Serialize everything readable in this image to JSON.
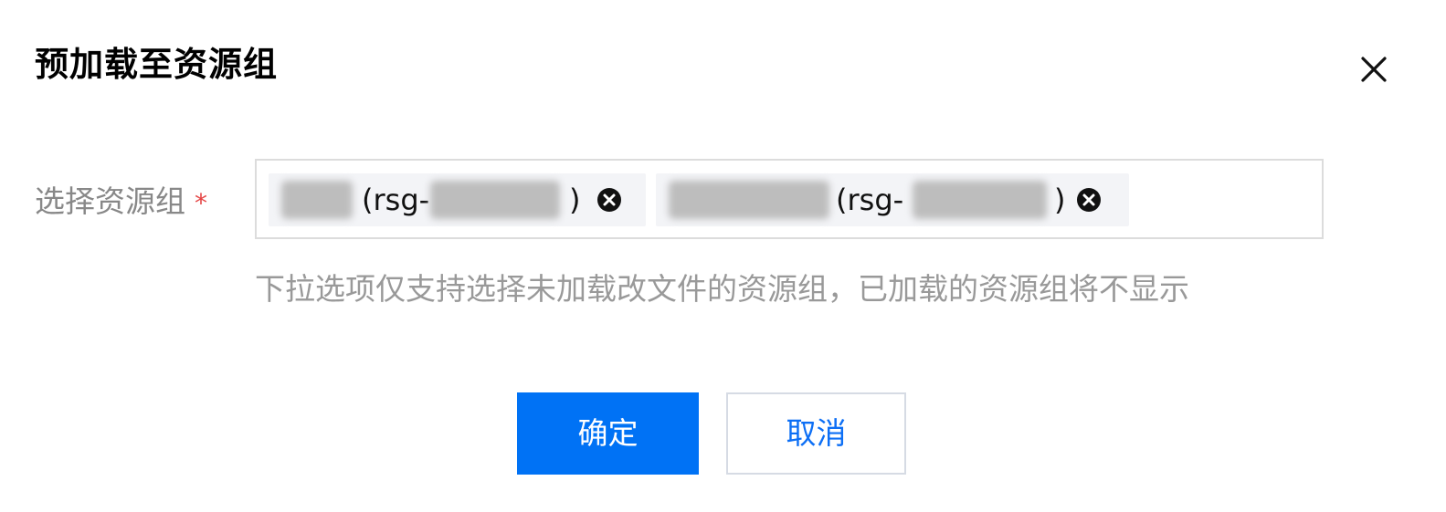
{
  "dialog": {
    "title": "预加载至资源组",
    "close_icon": "close-icon"
  },
  "form": {
    "label": "选择资源组",
    "required_mark": "*",
    "selected_tags": [
      {
        "prefix": "(rsg-",
        "suffix": ")",
        "remove_icon": "close-circle-icon"
      },
      {
        "prefix": "(rsg-",
        "suffix": ")",
        "remove_icon": "close-circle-icon"
      }
    ],
    "hint": "下拉选项仅支持选择未加载改文件的资源组，已加载的资源组将不显示"
  },
  "actions": {
    "confirm_label": "确定",
    "cancel_label": "取消"
  },
  "colors": {
    "primary": "#0072f5",
    "required": "#e54545",
    "tag_background": "#f3f4f7",
    "border": "#dcdcdc"
  }
}
